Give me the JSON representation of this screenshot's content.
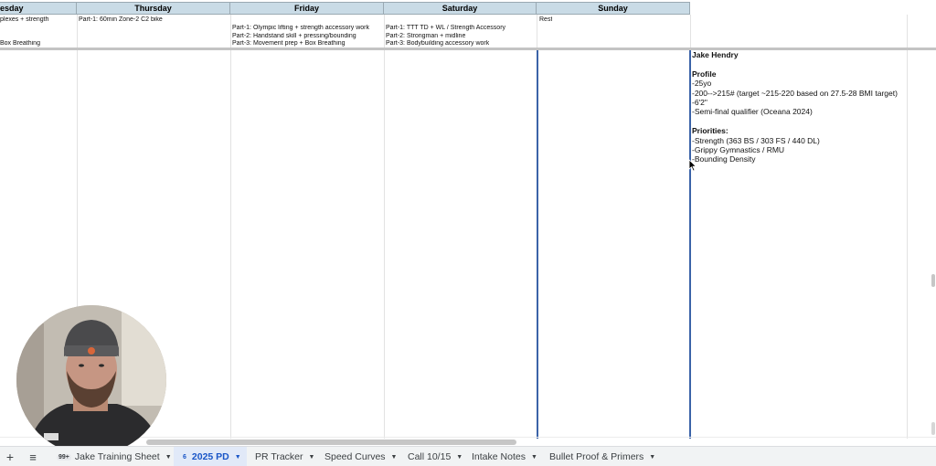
{
  "columns": {
    "wednesday_partial": "esday",
    "thursday": "Thursday",
    "friday": "Friday",
    "saturday": "Saturday",
    "sunday": "Sunday"
  },
  "cells": {
    "wed_line1": "plexes + strength",
    "wed_line2": "Box Breathing",
    "thu_line1": "Part-1: 60min Zone-2 C2 bike",
    "fri_line1": "Part-1: Olympic lifting + strength accessory work",
    "fri_line2": "Part-2: Handstand skill + pressing/bounding",
    "fri_line3": "Part-3: Movement prep + Box Breathing",
    "sat_line1": "Part-1: TTT TD + WL / Strength Accessory",
    "sat_line2": "Part-2: Strongman + midline",
    "sat_line3": "Part-3: Bodybuilding accessory work",
    "sun_line1": "Rest"
  },
  "notes": {
    "name": "Jake Hendry",
    "profile_heading": "Profile",
    "age": "-25yo",
    "weight": "-200-->215# (target ~215-220 based on 27.5-28 BMI target)",
    "height": "-6'2\"",
    "qualifier": "-Semi-final qualifier (Oceana 2024)",
    "priorities_heading": "Priorities:",
    "p1": "-Strength (363 BS / 303 FS / 440 DL)",
    "p2": "-Grippy Gymnastics / RMU",
    "p3": "-Bounding Density"
  },
  "tabs": {
    "add": "+",
    "menu": "≡",
    "t1_badge": "99+",
    "t1_label": "Jake Training Sheet",
    "t2_badge": "6",
    "t2_label": "2025 PD",
    "t3_label": "PR Tracker",
    "t4_label": "Speed Curves",
    "t5_label": "Call 10/15",
    "t6_label": "Intake Notes",
    "t7_label": "Bullet Proof & Primers",
    "caret": "▼"
  },
  "icons": {
    "add": "plus-icon",
    "menu": "all-sheets-icon",
    "caret": "caret-down-icon",
    "cursor": "mouse-pointer-icon"
  },
  "colors": {
    "header_bg": "#c9dbe6",
    "active_tab_bg": "#e1e9f8",
    "active_tab_text": "#1a56c7",
    "selection_border": "#3b63a8"
  }
}
